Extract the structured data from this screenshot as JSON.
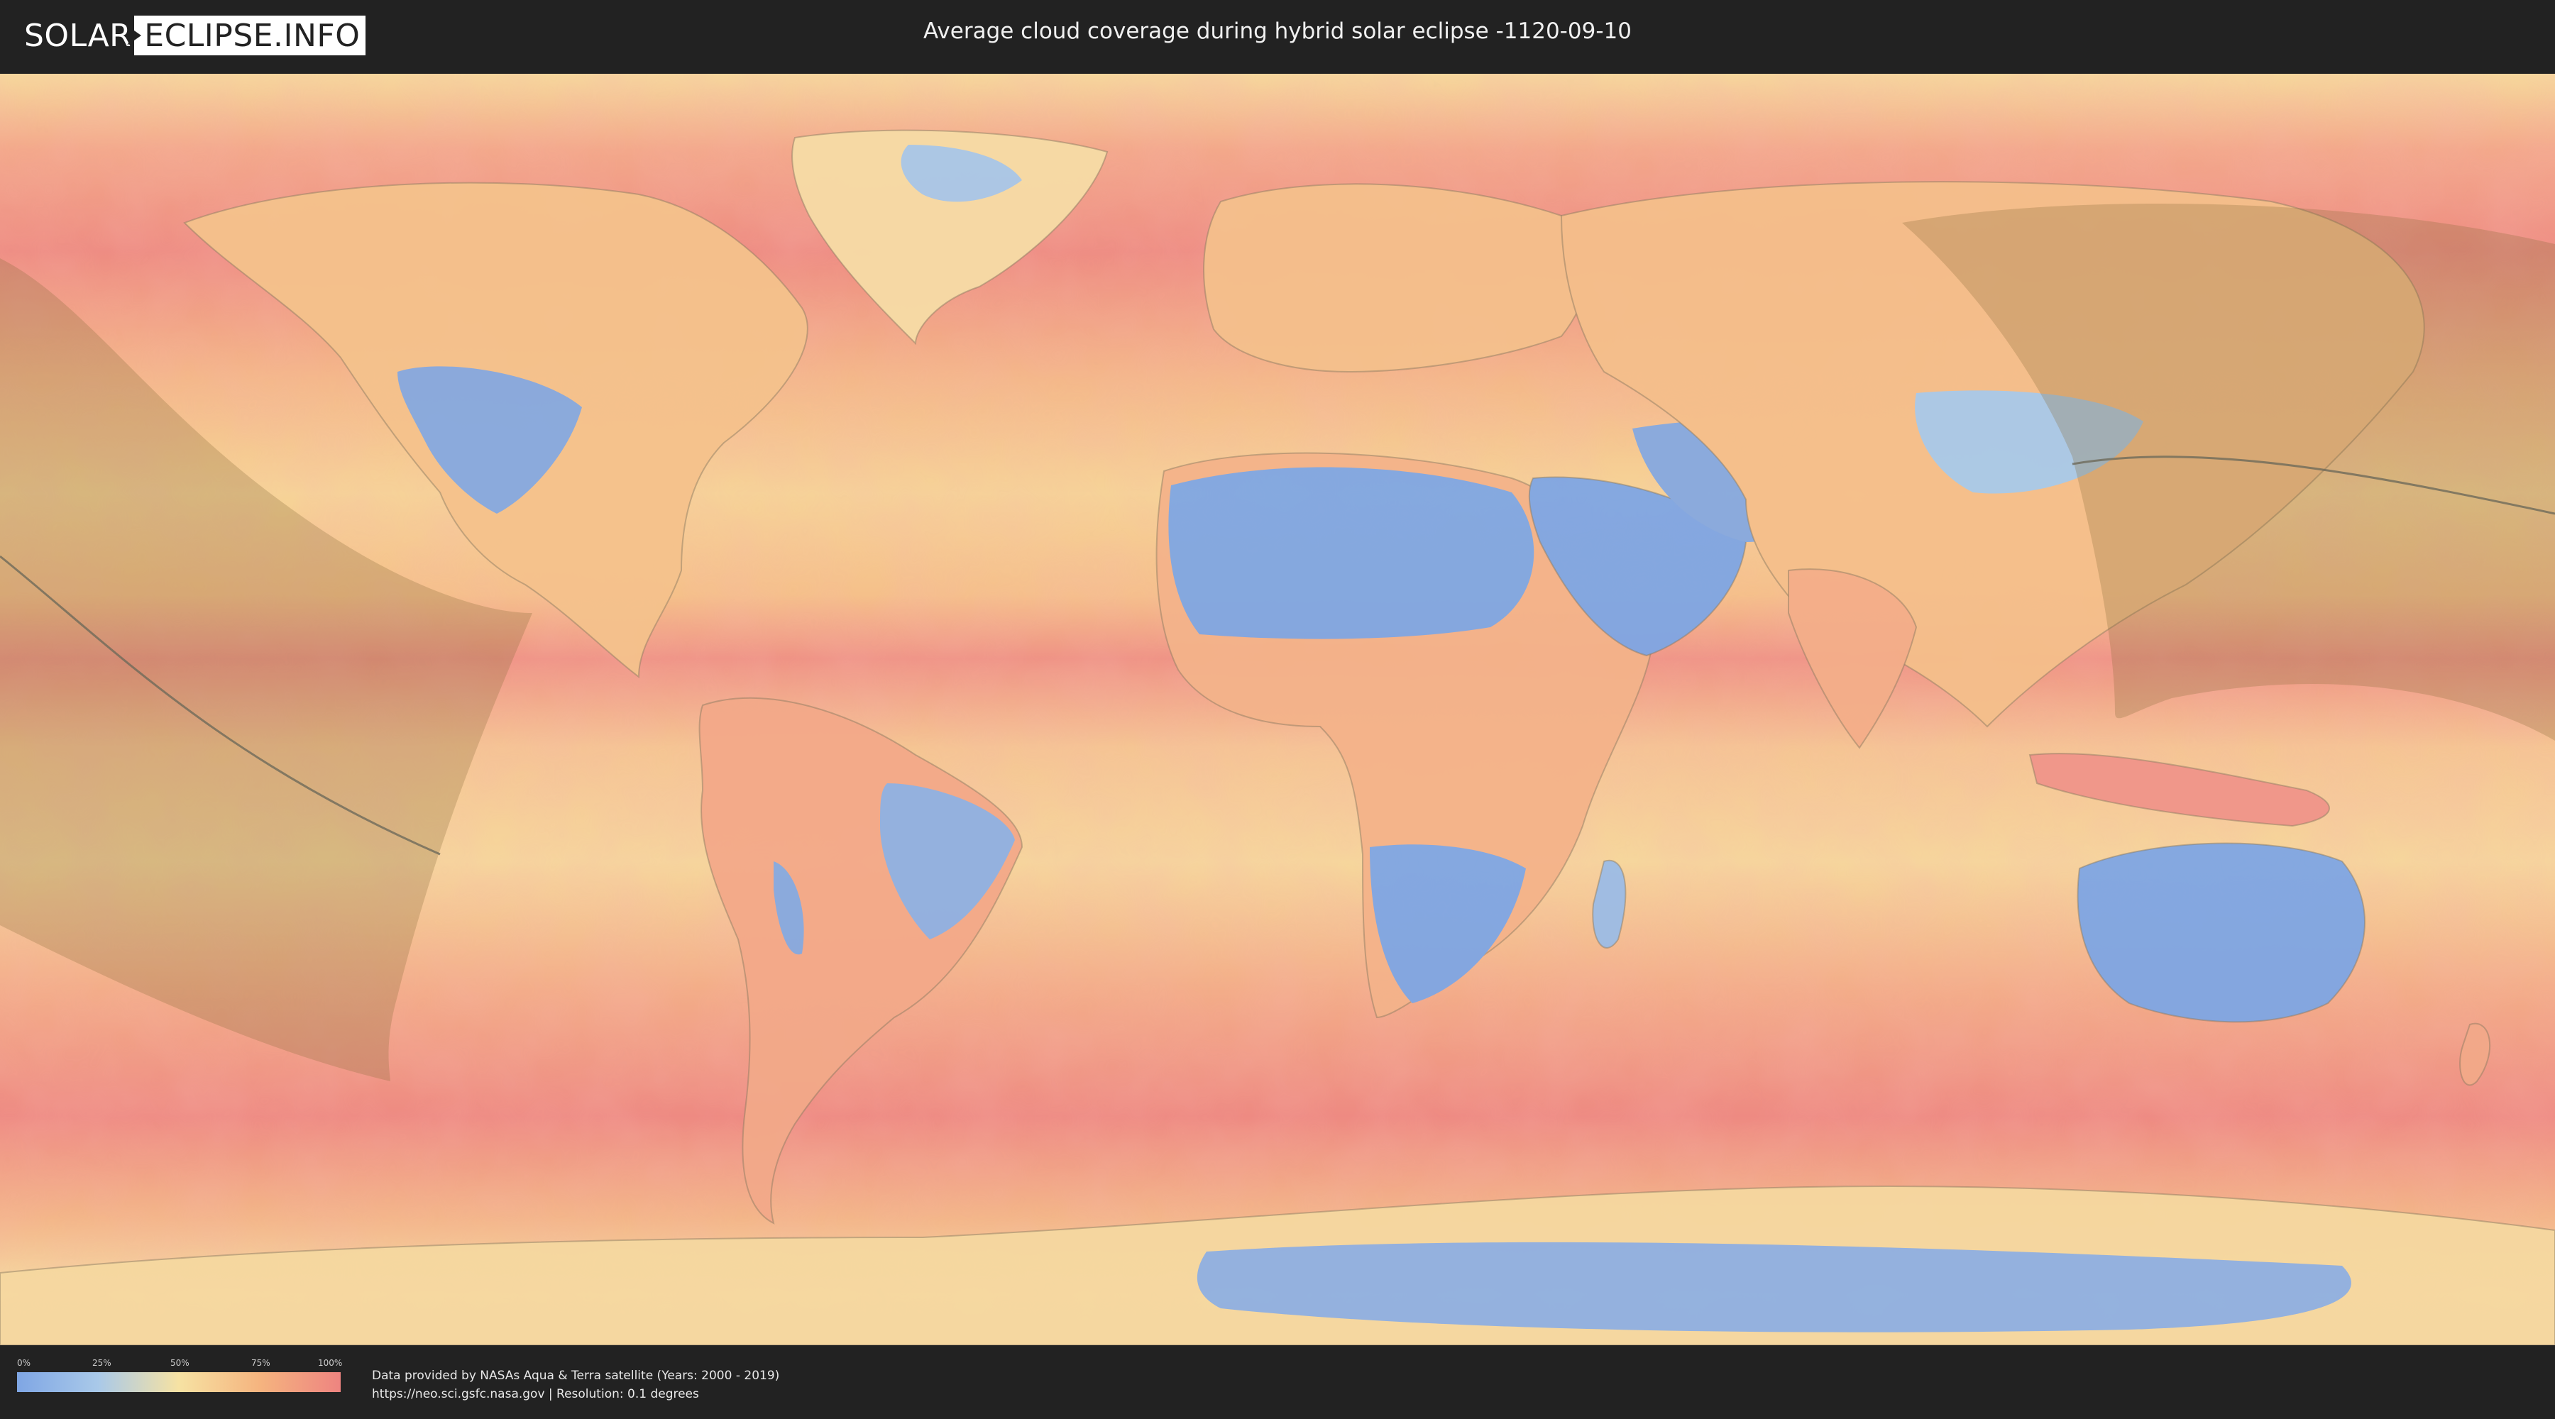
{
  "header": {
    "logo_part1": "SOLAR",
    "logo_part2": "ECLIPSE.INFO",
    "title": "Average cloud coverage during hybrid solar eclipse -1120-09-10"
  },
  "legend": {
    "ticks": [
      "0%",
      "25%",
      "50%",
      "75%",
      "100%"
    ],
    "colors": [
      "#7fa6e4",
      "#a9c9e9",
      "#f6e2a3",
      "#f5b47f",
      "#ee8480"
    ]
  },
  "credits": {
    "line1": "Data provided by NASAs Aqua & Terra satellite (Years: 2000 - 2019)",
    "line2": "https://neo.sci.gsfc.nasa.gov | Resolution: 0.1 degrees"
  },
  "map": {
    "colors": {
      "clear": "#7fa6e4",
      "low": "#a9c9e9",
      "mid": "#f6e2a3",
      "high": "#f5b47f",
      "overcast": "#ee8480",
      "eclipse_shadow": "#8a6a3a"
    },
    "icons": [
      "sun-icon"
    ]
  }
}
